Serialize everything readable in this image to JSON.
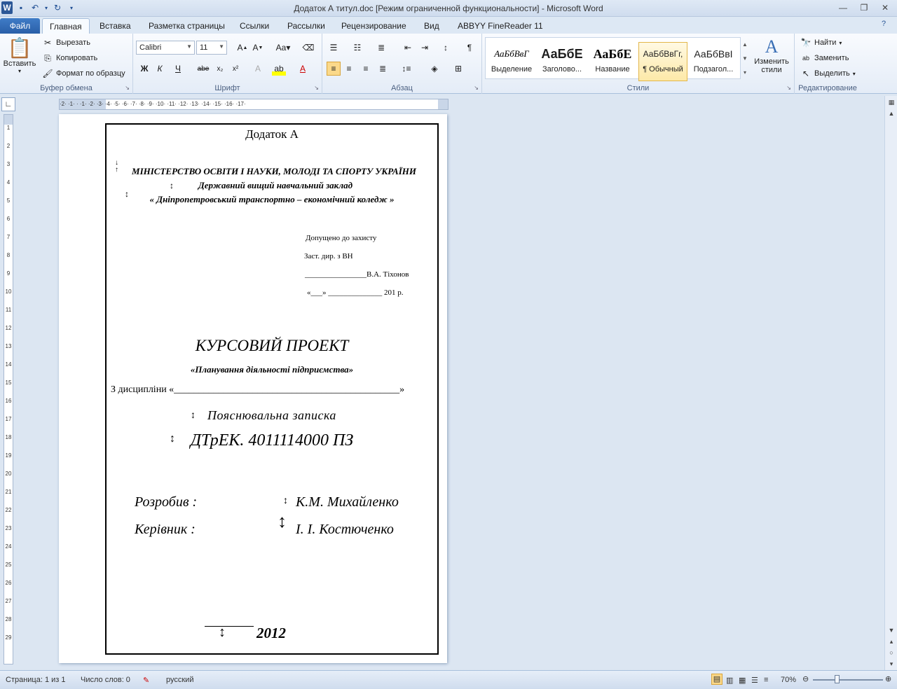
{
  "window": {
    "title": "Додаток А титул.doc [Режим ограниченной функциональности]  -  Microsoft Word"
  },
  "tabs": [
    "Файл",
    "Главная",
    "Вставка",
    "Разметка страницы",
    "Ссылки",
    "Рассылки",
    "Рецензирование",
    "Вид",
    "ABBYY FineReader 11"
  ],
  "ribbon": {
    "clipboard": {
      "label": "Буфер обмена",
      "paste": "Вставить",
      "cut": "Вырезать",
      "copy": "Копировать",
      "format_painter": "Формат по образцу"
    },
    "font": {
      "label": "Шрифт",
      "font_name": "Calibri",
      "font_size": "11"
    },
    "paragraph": {
      "label": "Абзац"
    },
    "styles": {
      "label": "Стили",
      "items": [
        {
          "preview": "АаБбВвГ",
          "name": "Выделение"
        },
        {
          "preview": "АаБбЕ",
          "name": "Заголово..."
        },
        {
          "preview": "АаБбЕ",
          "name": "Название"
        },
        {
          "preview": "АаБбВвГг,",
          "name": "¶ Обычный"
        },
        {
          "preview": "АаБбВвІ",
          "name": "Подзагол..."
        }
      ],
      "change_styles": "Изменить стили"
    },
    "editing": {
      "label": "Редактирование",
      "find": "Найти",
      "replace": "Заменить",
      "select": "Выделить"
    }
  },
  "ruler": {
    "h_ticks": "·2·  ·1·  ·  ·1·  ·2·  ·3·  ·4·  ·5·  ·6·  ·7·  ·8·  ·9·  ·10·  ·11·  ·12·  ·13·  ·14·  ·15·  ·16·  ·17·",
    "v_ticks": [
      "1",
      "2",
      "3",
      "4",
      "5",
      "6",
      "7",
      "8",
      "9",
      "10",
      "11",
      "12",
      "13",
      "14",
      "15",
      "16",
      "17",
      "18",
      "19",
      "20",
      "21",
      "22",
      "23",
      "24",
      "25",
      "26",
      "27",
      "28",
      "29"
    ]
  },
  "document": {
    "appendix": "Додаток А",
    "ministry": "МІНІСТЕРСТВО ОСВІТИ І НАУКИ, МОЛОДІ ТА СПОРТУ УКРАЇНИ",
    "institution": "Державний вищий навчальний заклад",
    "college": "« Дніпропетровський транспортно – економічний коледж »",
    "approved": "Допущено до захисту",
    "deputy": "Заст. дир. з ВН",
    "signature_line": "________________В.А. Тіхонов",
    "date_line": "«___»   ______________   201 р.",
    "project_title": "КУРСОВИЙ ПРОЕКТ",
    "project_topic": "«Планування діяльності підприємства»",
    "discipline": "З дисципліни «______________________________________________»",
    "note": "Пояснювальна  записка",
    "code": "ДТрЕК. 4011114000 ПЗ",
    "developed_label": "Розробив :",
    "developed_name": "К.М. Михайленко",
    "supervisor_label": "Керівник :",
    "supervisor_name": "І. І. Костюченко",
    "year": "2012"
  },
  "status": {
    "page": "Страница: 1 из 1",
    "words": "Число слов: 0",
    "language": "русский",
    "zoom": "70%"
  }
}
